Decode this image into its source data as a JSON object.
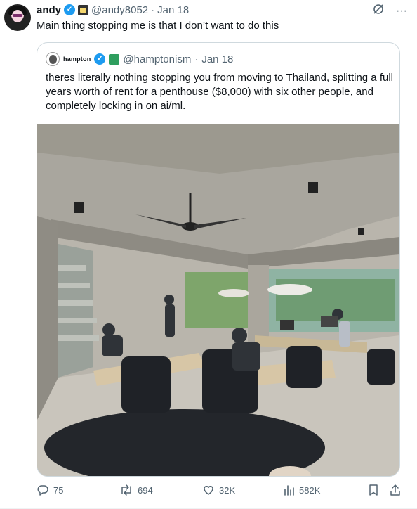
{
  "author": {
    "name": "andy",
    "handle": "@andy8052",
    "separator": "·",
    "date": "Jan 18",
    "verified_icon": "verified-badge-icon",
    "affiliate_icon": "emoji-badge-icon"
  },
  "post_text": "Main thing stopping me is that I don’t want to do this",
  "top_actions": {
    "grok_icon": "slash-circle-icon",
    "more_label": "···"
  },
  "quoted": {
    "name": "hampton",
    "handle": "@hamptonism",
    "separator": "·",
    "date": "Jan 18",
    "text": "theres literally nothing stopping you from moving to Thailand, splitting a full years worth of rent for a penthouse ($8,000) with six other people, and completely locking in on ai/ml.",
    "image_icon": "coworking-photo"
  },
  "actions": {
    "replies": "75",
    "reposts": "694",
    "likes": "32K",
    "views": "582K"
  },
  "colors": {
    "text": "#0f1419",
    "muted": "#536471",
    "accent": "#1d9bf0",
    "border": "#cfd9de"
  }
}
